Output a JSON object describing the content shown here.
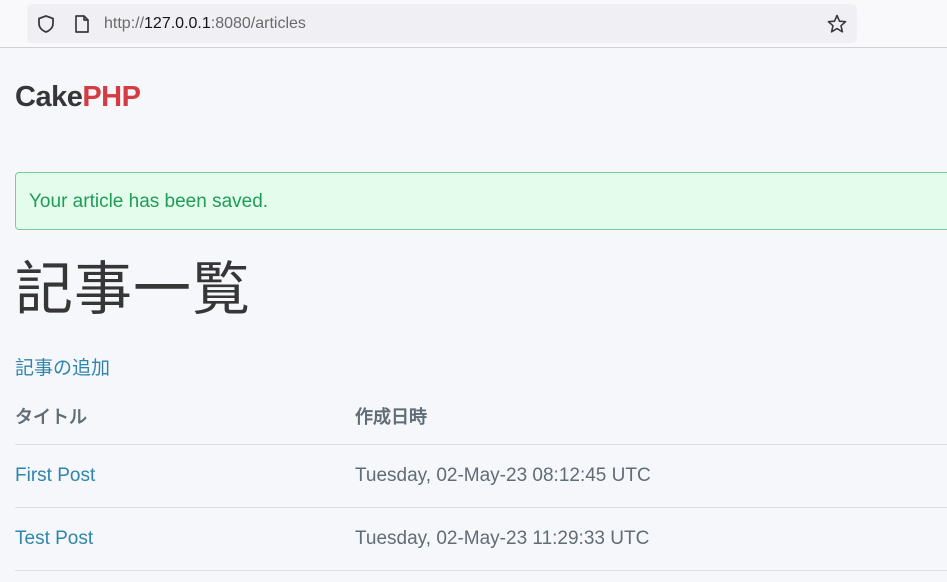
{
  "browser": {
    "url_prefix": "http://",
    "url_host": "127.0.0.1",
    "url_suffix": ":8080/articles"
  },
  "brand": {
    "part1": "Cake",
    "part2": "PHP"
  },
  "flash": {
    "message": "Your article has been saved."
  },
  "page": {
    "heading": "記事一覧",
    "add_link": "記事の追加"
  },
  "table": {
    "headers": [
      "タイトル",
      "作成日時"
    ],
    "rows": [
      {
        "title": "First Post",
        "created": "Tuesday, 02-May-23 08:12:45 UTC"
      },
      {
        "title": "Test Post",
        "created": "Tuesday, 02-May-23 11:29:33 UTC"
      }
    ]
  },
  "colors": {
    "brand_dark": "#363637",
    "brand_red": "#d33c43",
    "link": "#2f85ae",
    "flash_text": "#1f9d55",
    "flash_bg": "#e3fcec",
    "muted_text": "#606c76"
  }
}
